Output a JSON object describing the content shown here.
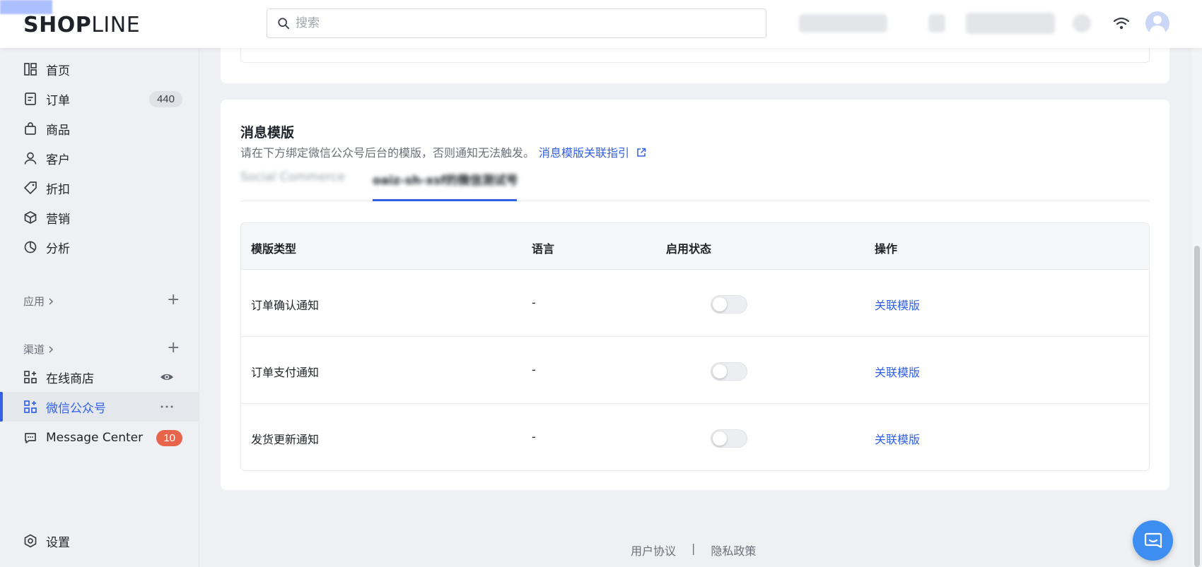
{
  "header": {
    "logo_bold": "SHOP",
    "logo_thin": "LINE",
    "search_placeholder": "搜索"
  },
  "sidebar": {
    "items": [
      {
        "label": "首页",
        "icon": "dashboard-icon"
      },
      {
        "label": "订单",
        "icon": "order-icon",
        "badge": "440"
      },
      {
        "label": "商品",
        "icon": "bag-icon"
      },
      {
        "label": "客户",
        "icon": "person-icon"
      },
      {
        "label": "折扣",
        "icon": "tag-icon"
      },
      {
        "label": "营销",
        "icon": "cube-icon"
      },
      {
        "label": "分析",
        "icon": "pie-chart-icon"
      }
    ],
    "apps_label": "应用",
    "channels_label": "渠道",
    "channels": [
      {
        "label": "在线商店",
        "icon": "grid-plus-icon"
      },
      {
        "label": "微信公众号",
        "icon": "grid-plus-icon",
        "active": true
      },
      {
        "label": "Message Center",
        "icon": "chat-icon",
        "badge": "10"
      }
    ],
    "settings_label": "设置"
  },
  "templates_card": {
    "title": "消息模版",
    "subtitle": "请在下方绑定微信公众号后台的模版，否则通知无法触发。",
    "guide_link": "消息模版关联指引",
    "columns": [
      "模版类型",
      "语言",
      "启用状态",
      "操作"
    ],
    "rows": [
      {
        "type": "订单确认通知",
        "language": "-",
        "enabled": false,
        "action": "关联模版"
      },
      {
        "type": "订单支付通知",
        "language": "-",
        "enabled": false,
        "action": "关联模版"
      },
      {
        "type": "发货更新通知",
        "language": "-",
        "enabled": false,
        "action": "关联模版"
      }
    ]
  },
  "footer": {
    "terms": "用户协议",
    "separator": "|",
    "privacy": "隐私政策"
  },
  "colors": {
    "accent": "#3261e6",
    "badge_red": "#e8654b",
    "chat_button": "#3d8ef0"
  }
}
